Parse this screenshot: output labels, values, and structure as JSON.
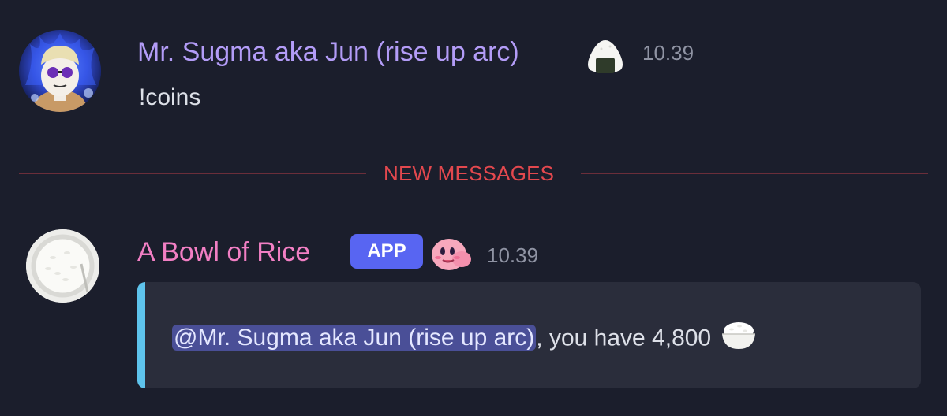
{
  "messages": [
    {
      "username": "Mr. Sugma aka Jun (rise up arc)",
      "username_color": "#b39cf7",
      "role_icon": "onigiri-icon",
      "timestamp": "10.39",
      "content": "!coins"
    },
    {
      "username": "A Bowl of Rice",
      "username_color": "#f27fc4",
      "badge": "APP",
      "role_icon": "kirby-icon",
      "timestamp": "10.39",
      "embed": {
        "mention": "@Mr. Sugma aka Jun (rise up arc)",
        "text": ", you have 4,800",
        "emoji": "rice-bowl-icon",
        "accent_color": "#5ec3ec"
      }
    }
  ],
  "divider": {
    "label": "NEW MESSAGES",
    "color": "#e3484e"
  }
}
